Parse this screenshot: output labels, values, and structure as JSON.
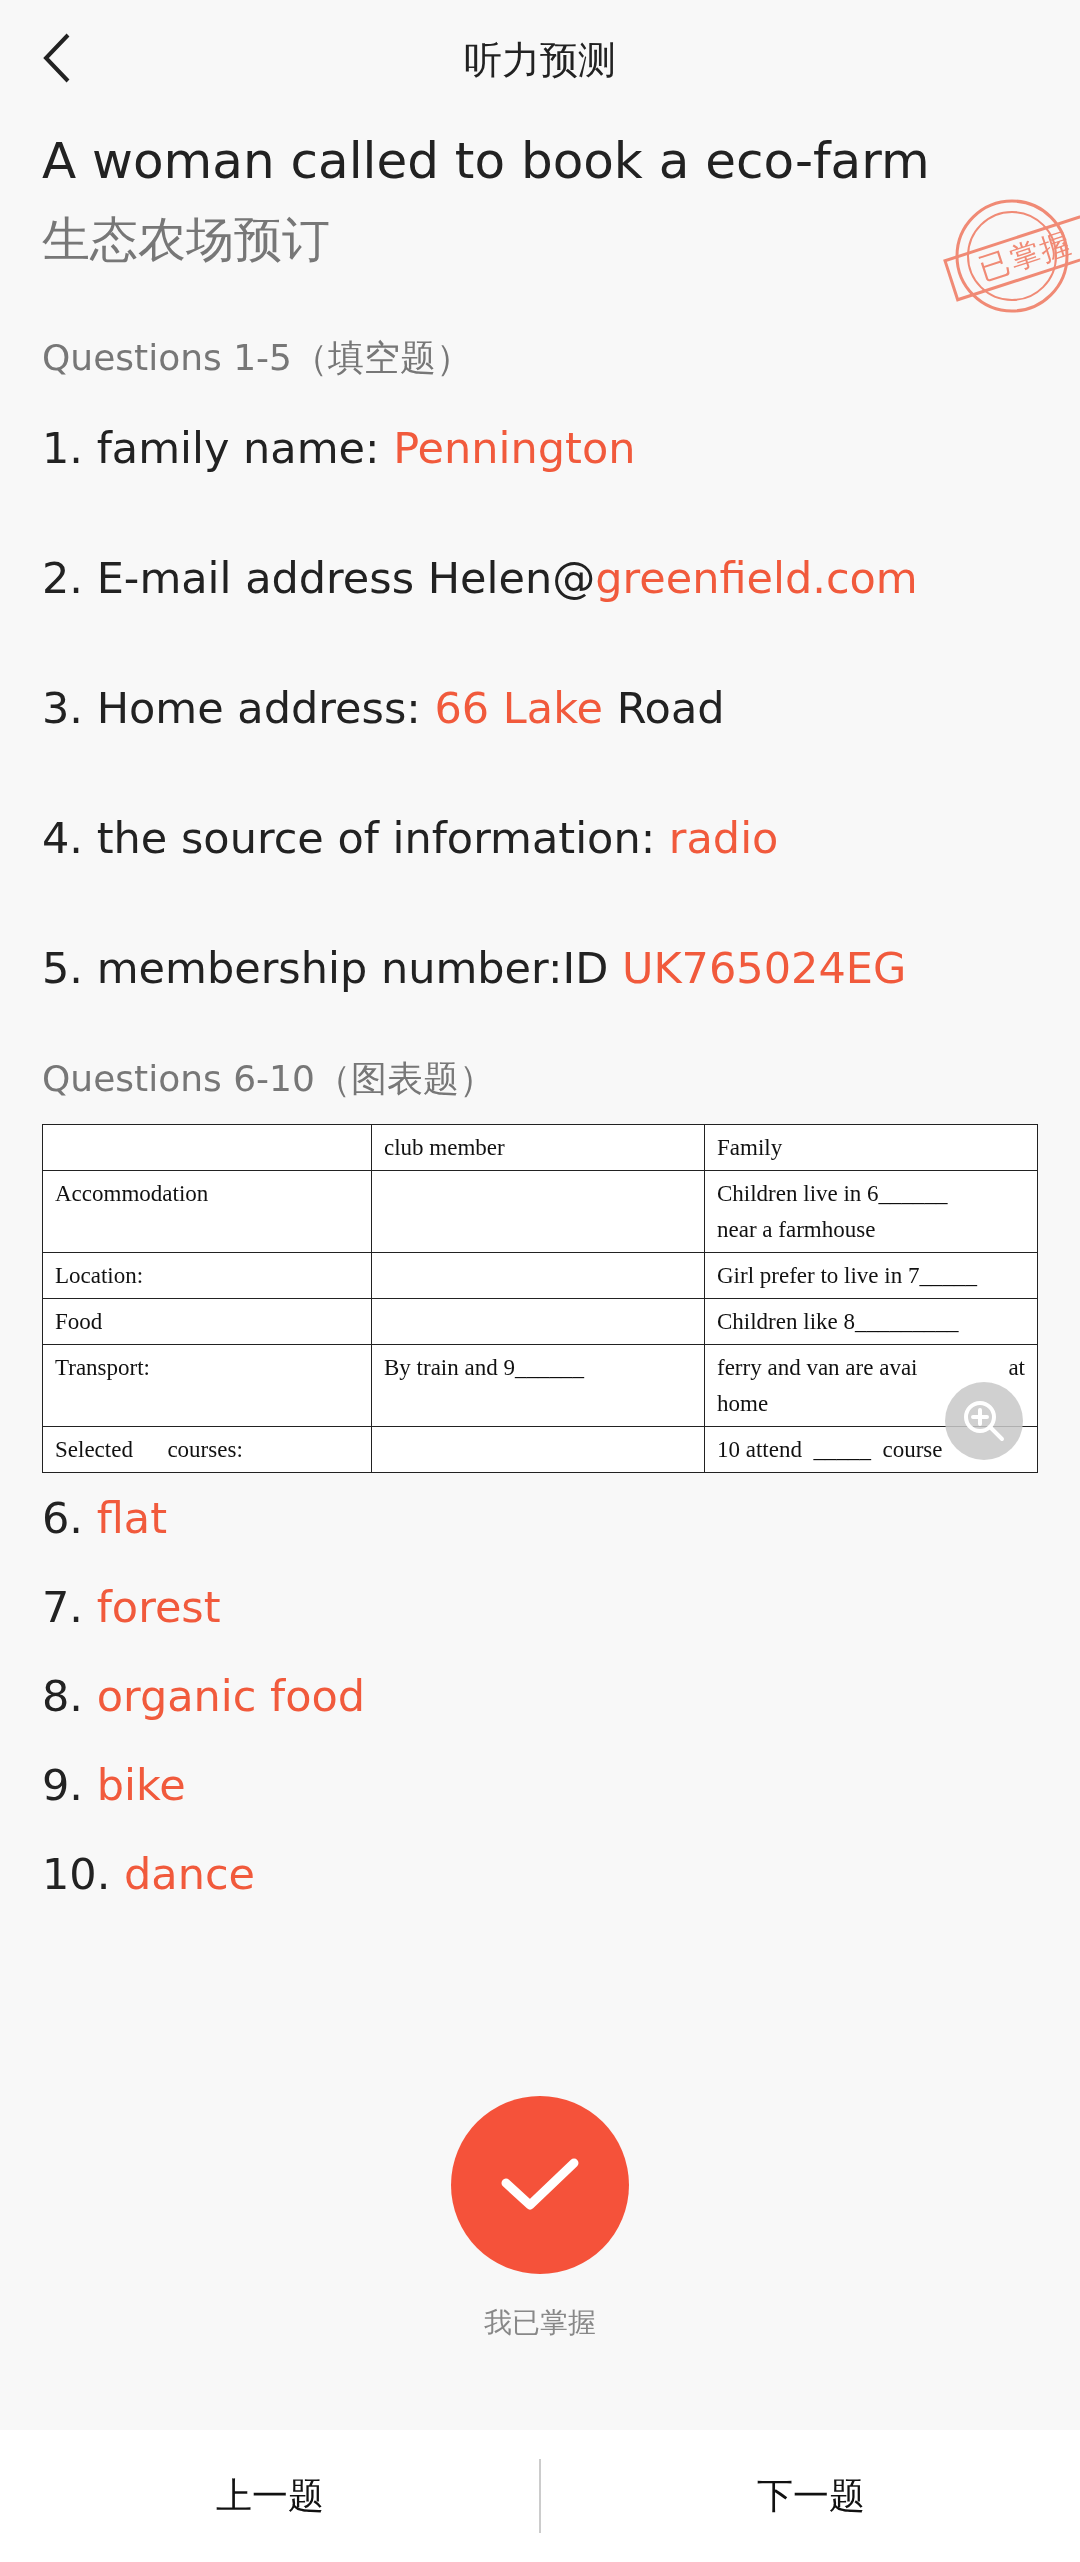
{
  "header": {
    "title": "听力预测"
  },
  "title": "A woman called to book a eco-farm",
  "subtitle": "生态农场预订",
  "stamp": {
    "text": "已掌握"
  },
  "section_1": {
    "heading": "Questions 1-5（填空题）",
    "items": [
      {
        "parts": [
          {
            "kind": "prompt",
            "text": "1. family name: "
          },
          {
            "kind": "answer",
            "text": "Pennington"
          }
        ]
      },
      {
        "parts": [
          {
            "kind": "prompt",
            "text": "2. E-mail address Helen@"
          },
          {
            "kind": "answer",
            "text": "greenfield.com"
          }
        ]
      },
      {
        "parts": [
          {
            "kind": "prompt",
            "text": "3. Home address: "
          },
          {
            "kind": "answer",
            "text": "66 Lake"
          },
          {
            "kind": "prompt",
            "text": " Road"
          }
        ]
      },
      {
        "parts": [
          {
            "kind": "prompt",
            "text": "4. the source of information: "
          },
          {
            "kind": "answer",
            "text": "radio"
          }
        ]
      },
      {
        "parts": [
          {
            "kind": "prompt",
            "text": "5. membership number:ID "
          },
          {
            "kind": "answer",
            "text": "UK765024EG"
          }
        ]
      }
    ]
  },
  "section_2": {
    "heading": "Questions 6-10（图表题）",
    "table": {
      "rows": [
        [
          {},
          {
            "lines": [
              [
                "club member"
              ]
            ]
          },
          {
            "lines": [
              [
                "Family"
              ]
            ]
          }
        ],
        [
          {
            "lines": [
              [
                "Accommodation"
              ]
            ]
          },
          {},
          {
            "lines": [
              [
                "Children live in 6______"
              ],
              [
                "near a farmhouse"
              ]
            ]
          }
        ],
        [
          {
            "lines": [
              [
                "Location:"
              ]
            ]
          },
          {},
          {
            "lines": [
              [
                "Girl prefer to live in 7_____"
              ]
            ]
          }
        ],
        [
          {
            "lines": [
              [
                "Food"
              ]
            ]
          },
          {},
          {
            "lines": [
              [
                "Children like 8_________"
              ]
            ]
          }
        ],
        [
          {
            "lines": [
              [
                "Transport:"
              ]
            ]
          },
          {
            "lines": [
              [
                "By train and 9______"
              ]
            ]
          },
          {
            "lines": [
              [
                "ferry and van are avai",
                "at"
              ],
              [
                "home"
              ]
            ]
          }
        ],
        [
          {
            "lines": [
              [
                "Selected      courses:"
              ]
            ]
          },
          {},
          {
            "lines": [
              [
                "10 attend  _____  course"
              ]
            ]
          }
        ]
      ]
    },
    "answers": [
      {
        "number": "6.",
        "answer": "flat"
      },
      {
        "number": "7.",
        "answer": "forest"
      },
      {
        "number": "8.",
        "answer": "organic food"
      },
      {
        "number": "9.",
        "answer": "bike"
      },
      {
        "number": "10.",
        "answer": "dance"
      }
    ]
  },
  "mastered": {
    "label": "我已掌握"
  },
  "bottom_bar": {
    "buttons": [
      "上一题",
      "下一题"
    ]
  }
}
